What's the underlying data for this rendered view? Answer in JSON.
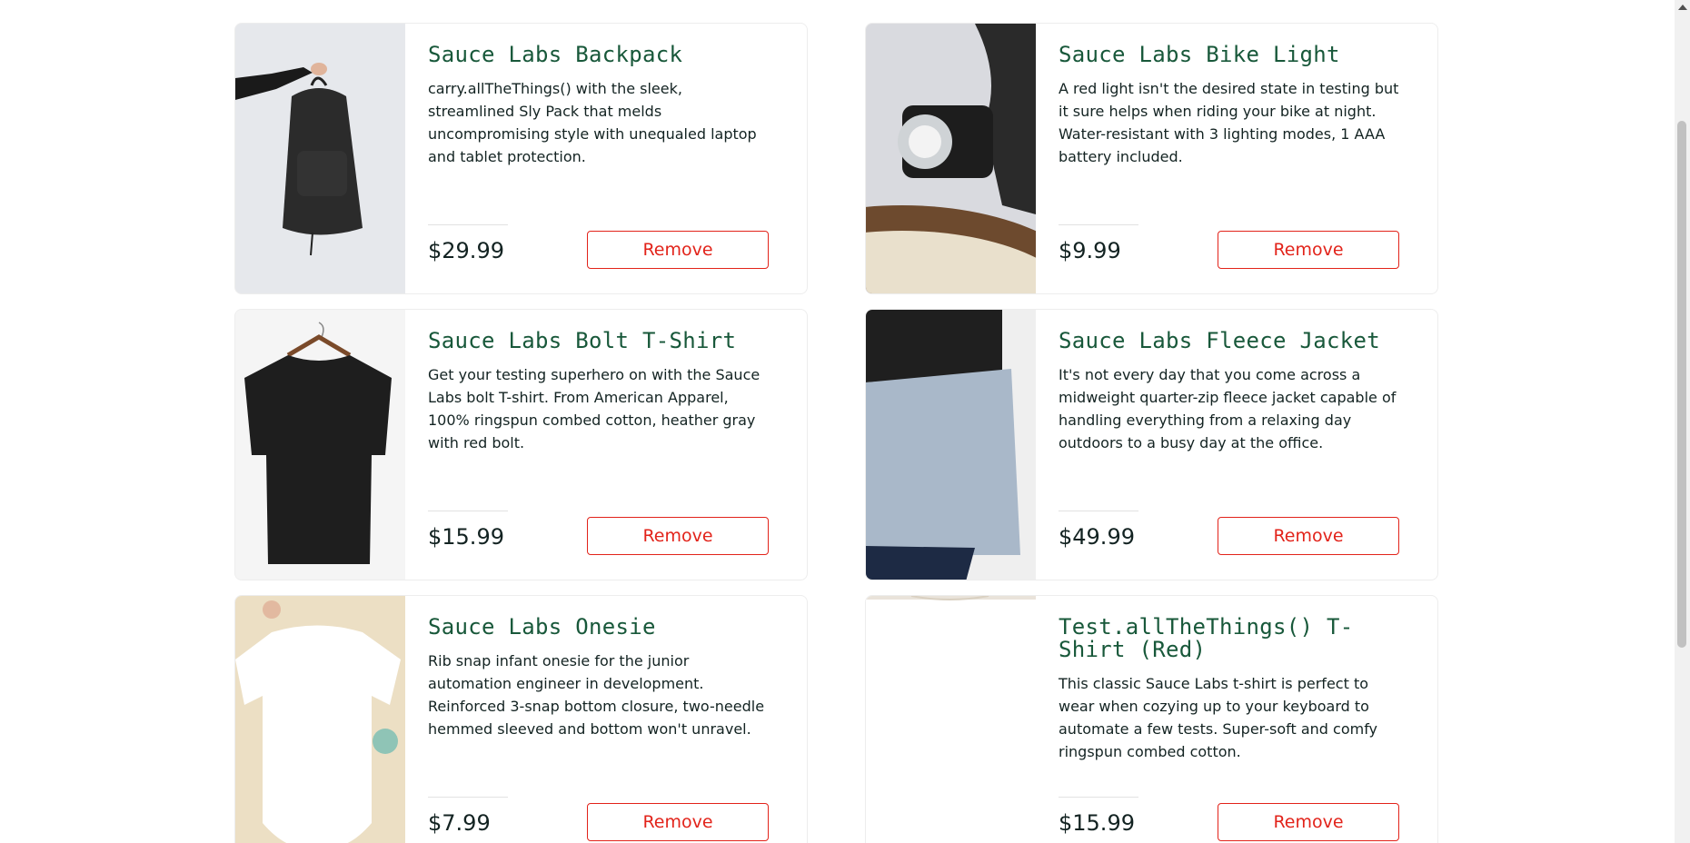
{
  "cart": {
    "items": [
      {
        "name": "Sauce Labs Backpack",
        "description": "carry.allTheThings() with the sleek, streamlined Sly Pack that melds uncompromising style with unequaled laptop and tablet protection.",
        "price": "$29.99",
        "button_label": "Remove"
      },
      {
        "name": "Sauce Labs Bike Light",
        "description": "A red light isn't the desired state in testing but it sure helps when riding your bike at night. Water-resistant with 3 lighting modes, 1 AAA battery included.",
        "price": "$9.99",
        "button_label": "Remove"
      },
      {
        "name": "Sauce Labs Bolt T-Shirt",
        "description": "Get your testing superhero on with the Sauce Labs bolt T-shirt. From American Apparel, 100% ringspun combed cotton, heather gray with red bolt.",
        "price": "$15.99",
        "button_label": "Remove"
      },
      {
        "name": "Sauce Labs Fleece Jacket",
        "description": "It's not every day that you come across a midweight quarter-zip fleece jacket capable of handling everything from a relaxing day outdoors to a busy day at the office.",
        "price": "$49.99",
        "button_label": "Remove"
      },
      {
        "name": "Sauce Labs Onesie",
        "description": "Rib snap infant onesie for the junior automation engineer in development. Reinforced 3-snap bottom closure, two-needle hemmed sleeved and bottom won't unravel.",
        "price": "$7.99",
        "button_label": "Remove"
      },
      {
        "name": "Test.allTheThings() T-Shirt (Red)",
        "description": "This classic Sauce Labs t-shirt is perfect to wear when cozying up to your keyboard to automate a few tests. Super-soft and comfy ringspun combed cotton.",
        "price": "$15.99",
        "button_label": "Remove"
      }
    ]
  },
  "colors": {
    "title_green": "#18583a",
    "remove_red": "#e2231a",
    "text_dark": "#132322"
  }
}
